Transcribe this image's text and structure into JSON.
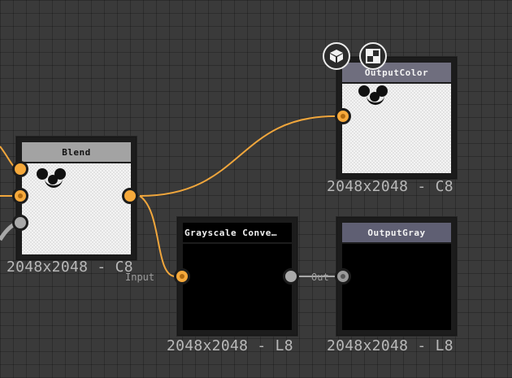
{
  "nodes": {
    "blend": {
      "title": "Blend",
      "resolution": "2048x2048 - C8",
      "title_bg": "#a3a3a3"
    },
    "output_color": {
      "title": "OutputColor",
      "resolution": "2048x2048 - C8",
      "title_bg": "#6f6e7e"
    },
    "grayscale": {
      "title": "Grayscale Conve…",
      "resolution": "2048x2048 - L8",
      "title_bg": "#000000",
      "input_label": "Input",
      "output_label": "Out"
    },
    "output_gray": {
      "title": "OutputGray",
      "resolution": "2048x2048 - L8",
      "title_bg": "#5f5f73"
    }
  },
  "toolbar": {
    "icons": [
      "3d-cube-icon",
      "checker-icon"
    ]
  },
  "colors": {
    "wire_color": "#f0a63c",
    "wire_gray": "#a8a8a8",
    "port_color": "#f6a93b",
    "port_gray": "#a9a9a9"
  }
}
